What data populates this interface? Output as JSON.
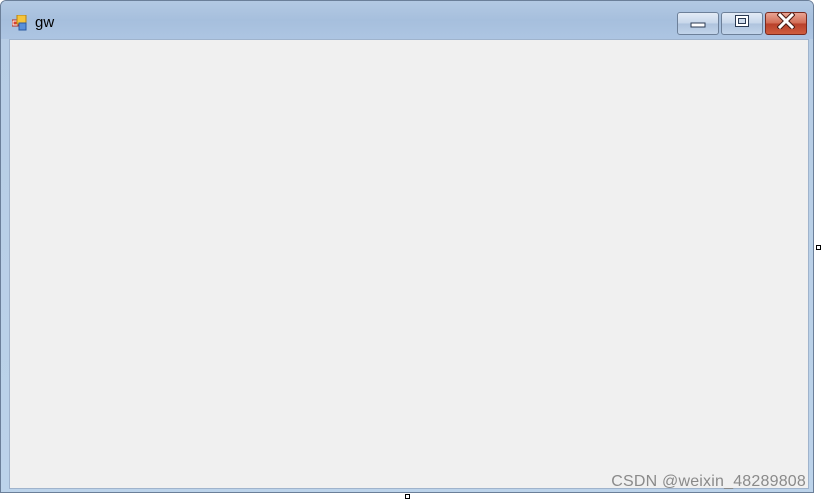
{
  "window": {
    "title": "gw",
    "icon": "form-icon",
    "caption_buttons": {
      "minimize": "minimize-icon",
      "maximize": "maximize-icon",
      "close": "close-icon"
    },
    "client_background": "#f0f0f0",
    "frame_color": "#b7cde5",
    "close_button_color": "#c9543a"
  },
  "watermark": {
    "text": "CSDN @weixin_48289808"
  }
}
